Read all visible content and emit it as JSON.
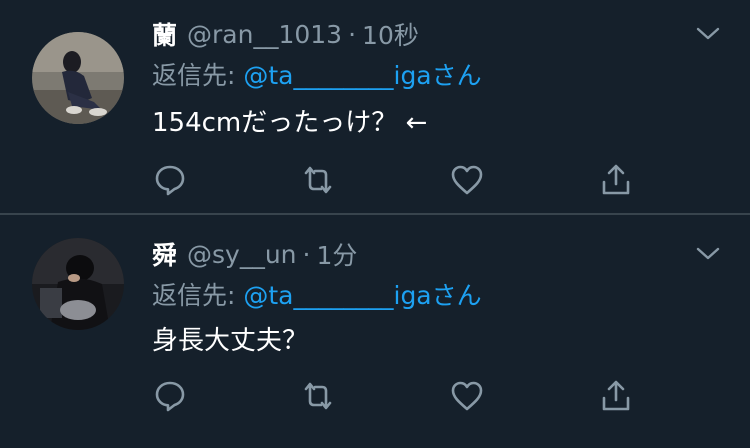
{
  "colors": {
    "background": "#15202b",
    "divider": "#38444d",
    "secondary_text": "#8899a6",
    "link": "#1da1f2"
  },
  "tweets": [
    {
      "name": "蘭",
      "handle": "@ran__1013",
      "separator": "·",
      "time": "10秒",
      "reply_prefix": "返信先: ",
      "reply_to": "@ta________iga",
      "reply_suffix": "さん",
      "text": "154cmだったっけ？ ←",
      "icons": [
        "chevron-down-icon",
        "reply-icon",
        "retweet-icon",
        "like-icon",
        "share-icon"
      ]
    },
    {
      "name": "舜",
      "handle": "@sy__un",
      "separator": "·",
      "time": "1分",
      "reply_prefix": "返信先: ",
      "reply_to": "@ta________iga",
      "reply_suffix": "さん",
      "text": "身長大丈夫？",
      "icons": [
        "chevron-down-icon",
        "reply-icon",
        "retweet-icon",
        "like-icon",
        "share-icon"
      ]
    }
  ]
}
